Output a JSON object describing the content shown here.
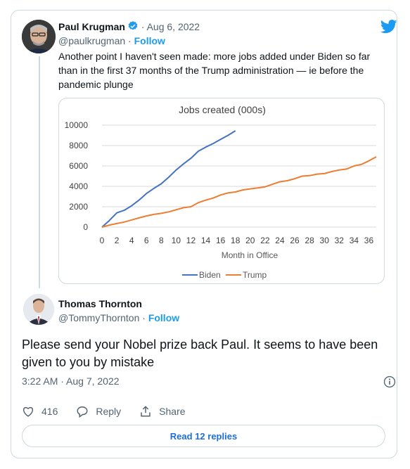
{
  "quoted": {
    "author_name": "Paul Krugman",
    "date": "· Aug 6, 2022",
    "handle": "@paulkrugman",
    "dot": " · ",
    "follow": "Follow",
    "text": "Another point I haven't seen made: more jobs added under Biden so far than in the first 37 months of the Trump administration — ie before the pandemic plunge"
  },
  "reply": {
    "author_name": "Thomas Thornton",
    "handle": "@TommyThornton",
    "dot": " · ",
    "follow": "Follow",
    "text": "Please send your Nobel prize back Paul.   It seems to have been given to you by mistake",
    "timestamp": "3:22 AM · Aug 7, 2022",
    "likes": "416",
    "reply_label": "Reply",
    "share_label": "Share",
    "read_replies": "Read 12 replies"
  },
  "colors": {
    "accent": "#1d9bf0",
    "biden": "#4472c4",
    "trump": "#ed7d31",
    "link": "#1d6fd6"
  },
  "icons": [
    "verified-badge-icon",
    "twitter-bird-icon",
    "info-icon",
    "heart-icon",
    "reply-bubble-icon",
    "share-icon"
  ],
  "chart_data": {
    "type": "line",
    "title": "Jobs created (000s)",
    "xlabel": "Month in Office",
    "ylabel": "",
    "xlim": [
      0,
      37
    ],
    "ylim": [
      0,
      10000
    ],
    "x_ticks": [
      0,
      2,
      4,
      6,
      8,
      10,
      12,
      14,
      16,
      18,
      20,
      22,
      24,
      26,
      28,
      30,
      32,
      34,
      36
    ],
    "y_ticks": [
      0,
      2000,
      4000,
      6000,
      8000,
      10000
    ],
    "legend_position": "bottom",
    "grid": true,
    "series": [
      {
        "name": "Biden",
        "x": [
          0,
          1,
          2,
          3,
          4,
          5,
          6,
          7,
          8,
          9,
          10,
          11,
          12,
          13,
          14,
          15,
          16,
          17,
          18
        ],
        "y": [
          0,
          650,
          1400,
          1650,
          2100,
          2650,
          3300,
          3800,
          4250,
          4900,
          5600,
          6200,
          6750,
          7450,
          7850,
          8200,
          8600,
          9000,
          9450
        ]
      },
      {
        "name": "Trump",
        "x": [
          0,
          1,
          2,
          3,
          4,
          5,
          6,
          7,
          8,
          9,
          10,
          11,
          12,
          13,
          14,
          15,
          16,
          17,
          18,
          19,
          20,
          21,
          22,
          23,
          24,
          25,
          26,
          27,
          28,
          29,
          30,
          31,
          32,
          33,
          34,
          35,
          36,
          37
        ],
        "y": [
          0,
          200,
          350,
          500,
          700,
          900,
          1100,
          1250,
          1350,
          1500,
          1700,
          1900,
          2000,
          2400,
          2650,
          2850,
          3150,
          3350,
          3450,
          3650,
          3750,
          3850,
          3950,
          4200,
          4450,
          4550,
          4750,
          5000,
          5050,
          5200,
          5250,
          5450,
          5600,
          5700,
          6000,
          6150,
          6500,
          6900
        ]
      }
    ]
  }
}
